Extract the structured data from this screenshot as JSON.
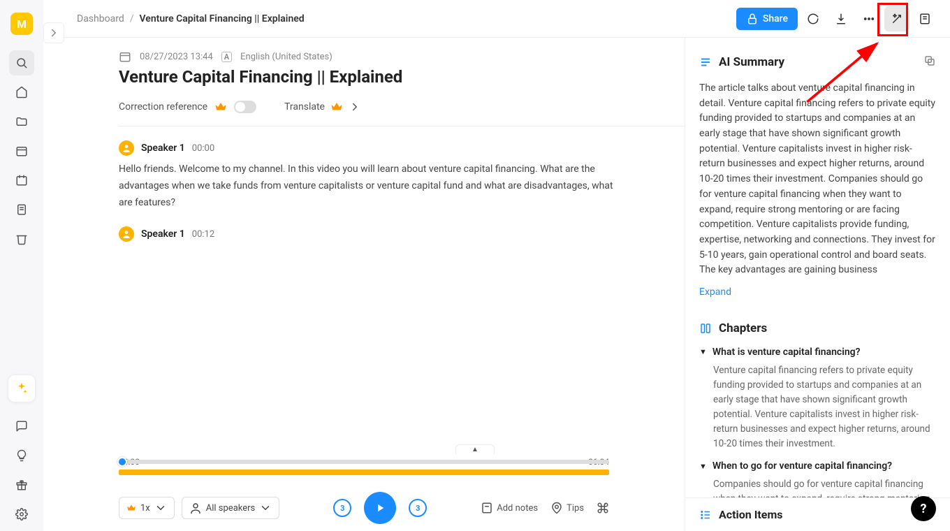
{
  "logo_letter": "M",
  "breadcrumb": {
    "dashboard": "Dashboard",
    "sep": "/",
    "title": "Venture Capital Financing || Explained"
  },
  "topbar": {
    "share": "Share"
  },
  "meta": {
    "date": "08/27/2023 13:44",
    "lang_badge": "A",
    "language": "English (United States)"
  },
  "doc_title": "Venture Capital Financing || Explained",
  "tools": {
    "correction": "Correction reference",
    "translate": "Translate"
  },
  "segments": [
    {
      "speaker": "Speaker 1",
      "time": "00:00",
      "text": "Hello friends. Welcome to my channel. In this video you will learn about venture capital financing. What are the advantages when we take funds from venture capitalists or venture capital fund and what are disadvantages, what are features?"
    },
    {
      "speaker": "Speaker 1",
      "time": "00:12",
      "text": ""
    }
  ],
  "player": {
    "start": "00:00",
    "end": "06:04",
    "speed": "1x",
    "speakers": "All speakers",
    "skip": "3",
    "addnotes": "Add notes",
    "tips": "Tips"
  },
  "summary": {
    "title": "AI Summary",
    "text": "The article talks about venture capital financing in detail. Venture capital financing refers to private equity funding provided to startups and companies at an early stage that have shown significant growth potential. Venture capitalists invest in higher risk-return businesses and expect higher returns, around 10-20 times their investment. Companies should go for venture capital financing when they want to expand, require strong mentoring or are facing competition. Venture capitalists provide funding, expertise, networking and connections. They invest for 5-10 years, gain operational control and board seats. The key advantages are gaining business",
    "expand": "Expand"
  },
  "chapters": {
    "title": "Chapters",
    "items": [
      {
        "title": "What is venture capital financing?",
        "body": "Venture capital financing refers to private equity funding provided to startups and companies at an early stage that have shown significant growth potential. Venture capitalists invest in higher risk-return businesses and expect higher returns, around 10-20 times their investment."
      },
      {
        "title": "When to go for venture capital financing?",
        "body": "Companies should go for venture capital financing when they want to expand, require strong mentoring"
      }
    ]
  },
  "action_items": {
    "title": "Action Items"
  },
  "help": "?"
}
